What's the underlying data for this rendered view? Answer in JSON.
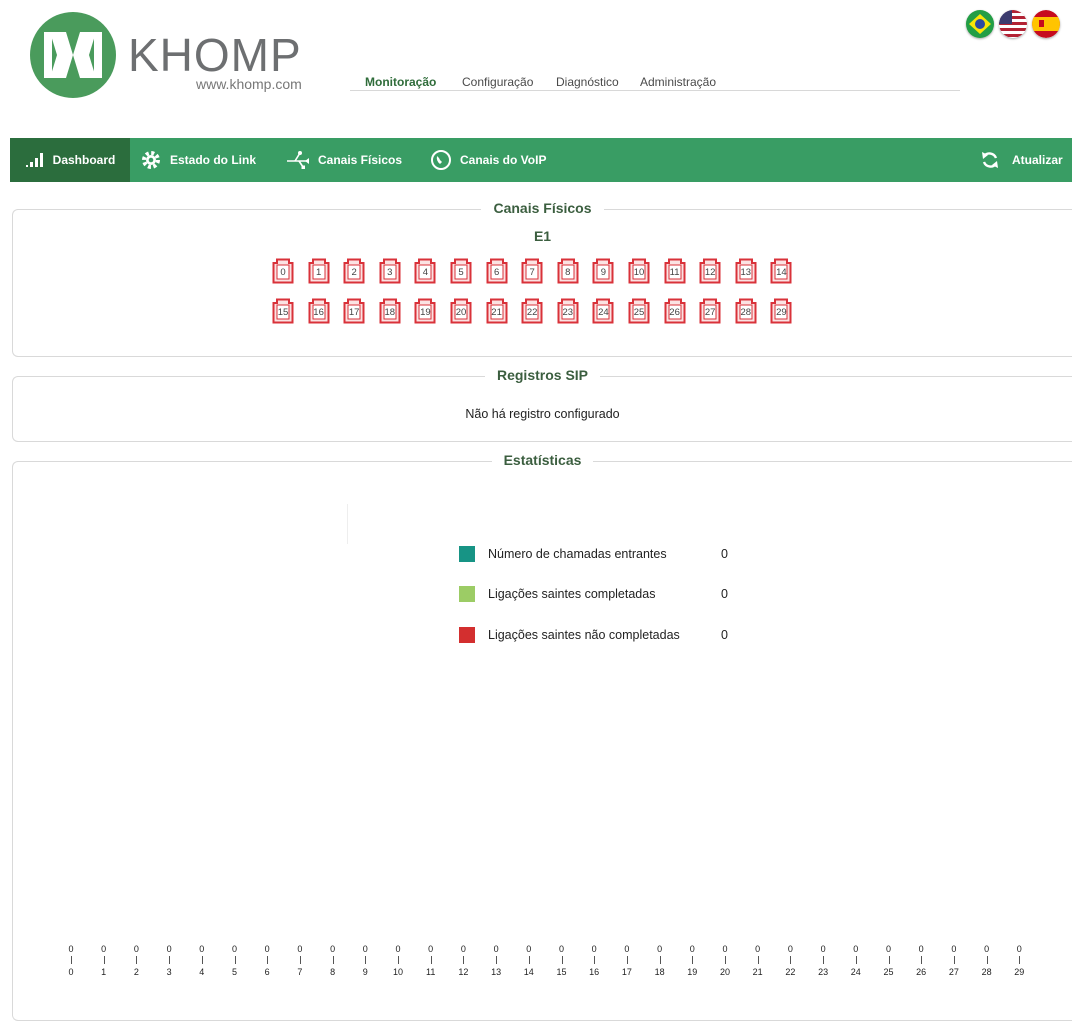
{
  "header": {
    "brand": "KHOMP",
    "url": "www.khomp.com",
    "nav": [
      "Monitoração",
      "Configuração",
      "Diagnóstico",
      "Administração"
    ],
    "flags": [
      {
        "name": "brazil-flag-icon",
        "colors": [
          "#229e45",
          "#f8e509",
          "#2b49a3"
        ]
      },
      {
        "name": "usa-flag-icon",
        "colors": [
          "#b22234",
          "#ffffff",
          "#3c3b6e"
        ]
      },
      {
        "name": "spain-flag-icon",
        "colors": [
          "#c60b1e",
          "#ffc400",
          "#c60b1e"
        ]
      }
    ]
  },
  "toolbar": {
    "dashboard": "Dashboard",
    "link_state": "Estado do Link",
    "physical_channels": "Canais Físicos",
    "voip_channels": "Canais do VoIP",
    "refresh": "Atualizar"
  },
  "canais": {
    "title": "Canais Físicos",
    "link": "E1",
    "channels": [
      "0",
      "1",
      "2",
      "3",
      "4",
      "5",
      "6",
      "7",
      "8",
      "9",
      "10",
      "11",
      "12",
      "13",
      "14",
      "15",
      "16",
      "17",
      "18",
      "19",
      "20",
      "21",
      "22",
      "23",
      "24",
      "25",
      "26",
      "27",
      "28",
      "29"
    ],
    "channel_color": "#d9323a"
  },
  "sip": {
    "title": "Registros SIP",
    "message": "Não há registro configurado"
  },
  "stats": {
    "title": "Estatísticas",
    "legend": [
      {
        "label": "Número de chamadas entrantes",
        "value": "0",
        "color": "#179485"
      },
      {
        "label": "Ligações saintes completadas",
        "value": "0",
        "color": "#9ccc65"
      },
      {
        "label": "Ligações saintes não completadas",
        "value": "0",
        "color": "#d32f2f"
      }
    ]
  },
  "chart_data": {
    "type": "bar",
    "categories": [
      "0",
      "1",
      "2",
      "3",
      "4",
      "5",
      "6",
      "7",
      "8",
      "9",
      "10",
      "11",
      "12",
      "13",
      "14",
      "15",
      "16",
      "17",
      "18",
      "19",
      "20",
      "21",
      "22",
      "23",
      "24",
      "25",
      "26",
      "27",
      "28",
      "29"
    ],
    "value_labels": [
      "0",
      "0",
      "0",
      "0",
      "0",
      "0",
      "0",
      "0",
      "0",
      "0",
      "0",
      "0",
      "0",
      "0",
      "0",
      "0",
      "0",
      "0",
      "0",
      "0",
      "0",
      "0",
      "0",
      "0",
      "0",
      "0",
      "0",
      "0",
      "0",
      "0"
    ],
    "series": [
      {
        "name": "Número de chamadas entrantes",
        "values": [
          0,
          0,
          0,
          0,
          0,
          0,
          0,
          0,
          0,
          0,
          0,
          0,
          0,
          0,
          0,
          0,
          0,
          0,
          0,
          0,
          0,
          0,
          0,
          0,
          0,
          0,
          0,
          0,
          0,
          0
        ]
      },
      {
        "name": "Ligações saintes completadas",
        "values": [
          0,
          0,
          0,
          0,
          0,
          0,
          0,
          0,
          0,
          0,
          0,
          0,
          0,
          0,
          0,
          0,
          0,
          0,
          0,
          0,
          0,
          0,
          0,
          0,
          0,
          0,
          0,
          0,
          0,
          0
        ]
      },
      {
        "name": "Ligações saintes não completadas",
        "values": [
          0,
          0,
          0,
          0,
          0,
          0,
          0,
          0,
          0,
          0,
          0,
          0,
          0,
          0,
          0,
          0,
          0,
          0,
          0,
          0,
          0,
          0,
          0,
          0,
          0,
          0,
          0,
          0,
          0,
          0
        ]
      }
    ]
  }
}
